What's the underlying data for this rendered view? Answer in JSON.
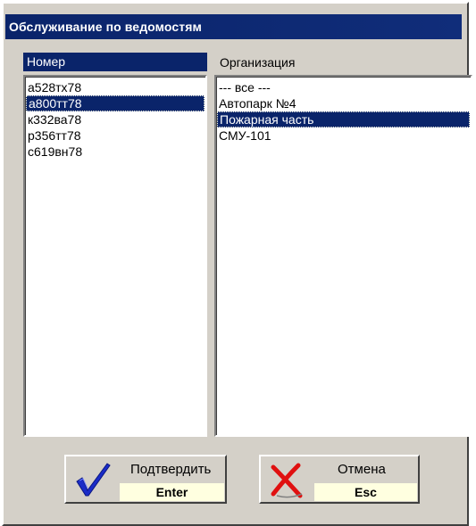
{
  "window": {
    "title": "Обслуживание по ведомостям"
  },
  "left_list": {
    "header": "Номер",
    "items": [
      "а528тх78",
      "а800тт78",
      "к332ва78",
      "р356тт78",
      "с619вн78"
    ],
    "selected_index": 1
  },
  "right_list": {
    "header": "Организация",
    "items": [
      "--- все ---",
      "Автопарк №4",
      "Пожарная часть",
      "СМУ-101"
    ],
    "selected_index": 2
  },
  "buttons": {
    "confirm": {
      "label": "Подтвердить",
      "key": "Enter",
      "icon": "checkmark-icon"
    },
    "cancel": {
      "label": "Отмена",
      "key": "Esc",
      "icon": "cross-icon"
    }
  },
  "colors": {
    "titlebar": "#0a246a",
    "selection": "#0a246a",
    "face": "#d4d0c8",
    "key_background": "#ffffe0"
  }
}
